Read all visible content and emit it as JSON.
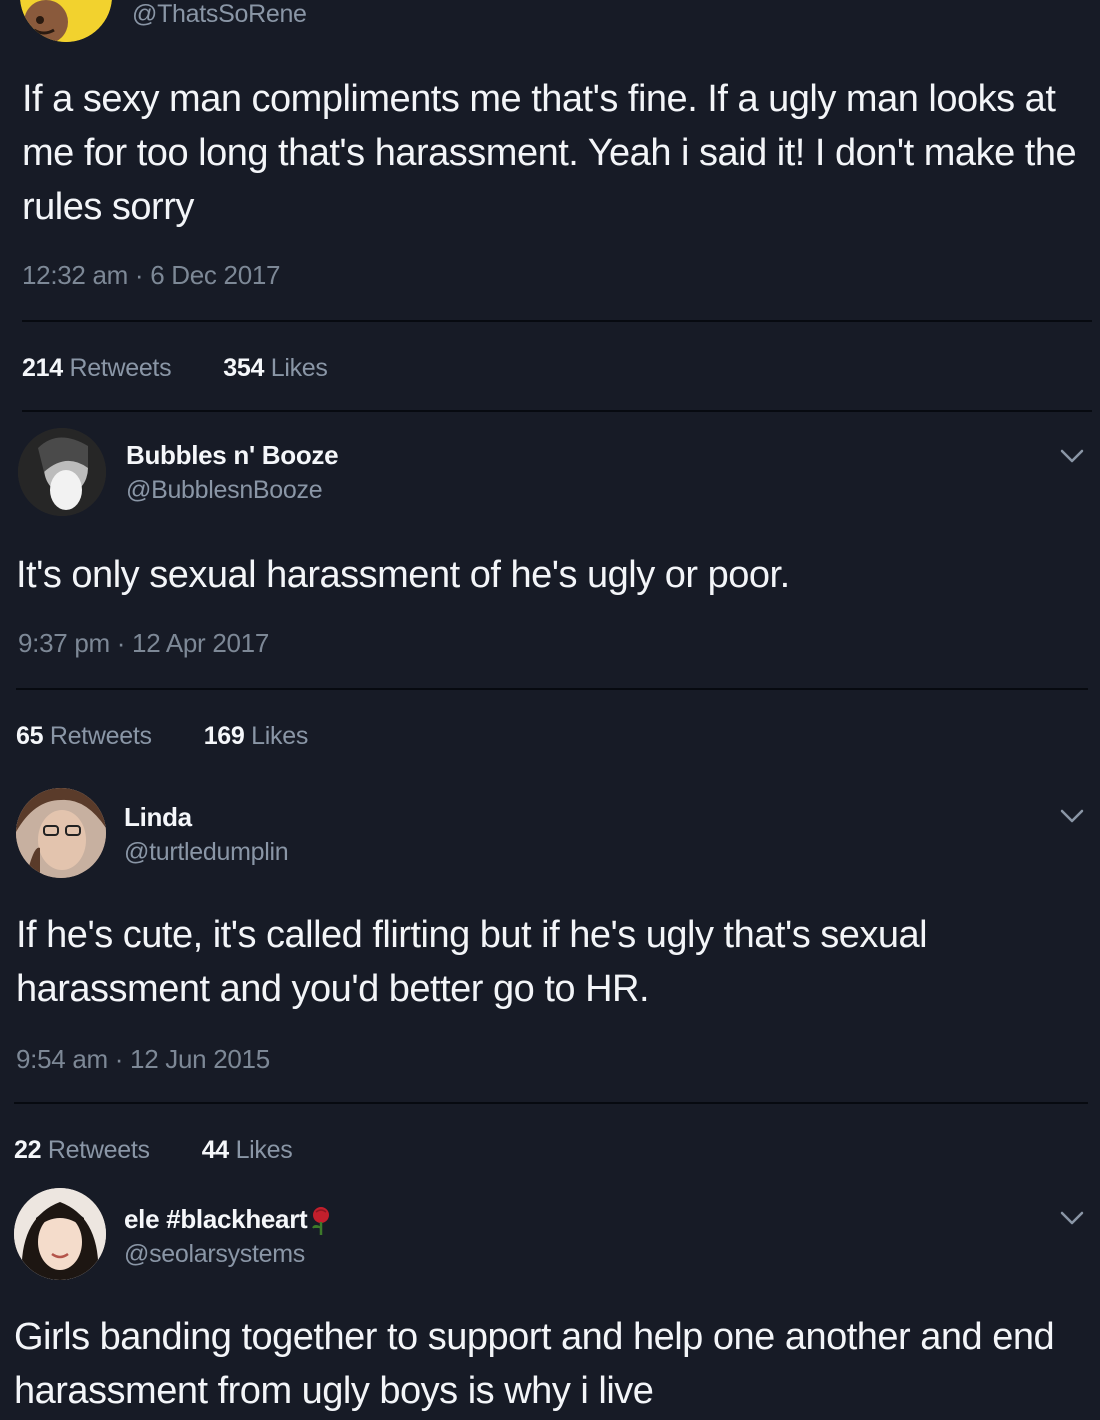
{
  "colors": {
    "background": "#171b26",
    "divider": "#070a10",
    "text_primary": "#f3f5f8",
    "text_secondary": "#8a96a6"
  },
  "tweets": [
    {
      "handle": "@ThatsSoRene",
      "avatar_icon": "avatar-yellow-emoji",
      "text": "If a sexy man compliments me that's fine. If a ugly man looks at me for too long that's harassment. Yeah i said it! I don't make the rules sorry",
      "timestamp": "12:32 am · 6 Dec 2017",
      "retweets": "214",
      "retweets_label": "Retweets",
      "likes": "354",
      "likes_label": "Likes"
    },
    {
      "display_name": "Bubbles n' Booze",
      "handle": "@BubblesnBooze",
      "text": "It's only sexual harassment of he's ugly or poor.",
      "timestamp": "9:37 pm · 12 Apr 2017",
      "retweets": "65",
      "retweets_label": "Retweets",
      "likes": "169",
      "likes_label": "Likes"
    },
    {
      "display_name": "Linda",
      "handle": "@turtledumplin",
      "text": "If he's cute, it's called flirting but if he's ugly that's sexual harassment and you'd better go to HR.",
      "timestamp": "9:54 am · 12 Jun 2015",
      "retweets": "22",
      "retweets_label": "Retweets",
      "likes": "44",
      "likes_label": "Likes"
    },
    {
      "display_name": "ele #blackheart",
      "name_emoji": "rose-icon",
      "handle": "@seolarsystems",
      "text": "Girls banding together to support and help one another and end harassment from ugly boys is why i live"
    }
  ]
}
